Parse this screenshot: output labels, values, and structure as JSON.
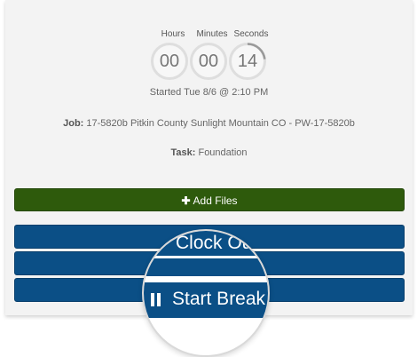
{
  "timer": {
    "labels": {
      "hours": "Hours",
      "minutes": "Minutes",
      "seconds": "Seconds"
    },
    "values": {
      "hours": "00",
      "minutes": "00",
      "seconds": "14"
    },
    "seconds_progress": 0.23
  },
  "started_text": "Started Tue 8/6 @ 2:10 PM",
  "job": {
    "label": "Job:",
    "value": "17-5820b Pitkin County Sunlight Mountain CO - PW-17-5820b"
  },
  "task": {
    "label": "Task:",
    "value": "Foundation"
  },
  "buttons": {
    "add_files": "Add Files",
    "add_files_icon": "plus-icon",
    "clock_out": "Clock Ou",
    "start_break": "Start Break",
    "start_break_icon": "pause-icon"
  },
  "colors": {
    "card_bg": "#f3f3f3",
    "green_button": "#2e5a0c",
    "blue_button": "#0b4f86",
    "ring": "#dedede",
    "arc": "#999999"
  }
}
